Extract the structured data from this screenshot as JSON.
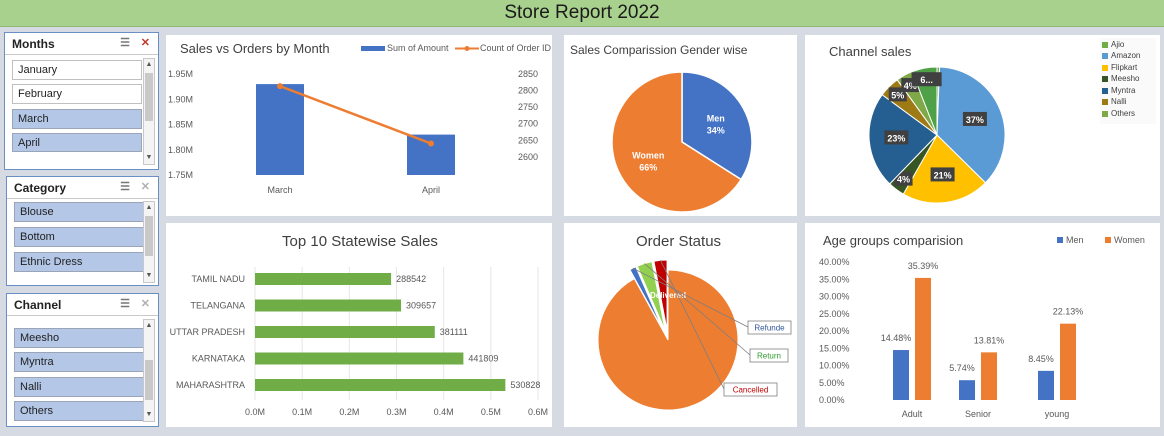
{
  "report_title": "Store Report 2022",
  "slicers": {
    "months": {
      "title": "Months",
      "items": [
        "January",
        "February",
        "March",
        "April"
      ],
      "selected": [
        false,
        false,
        true,
        true
      ]
    },
    "category": {
      "title": "Category",
      "items": [
        "Blouse",
        "Bottom",
        "Ethnic Dress"
      ],
      "selected": [
        true,
        true,
        true
      ]
    },
    "channel": {
      "title": "Channel",
      "items": [
        "Meesho",
        "Myntra",
        "Nalli",
        "Others"
      ],
      "selected": [
        true,
        true,
        true,
        true
      ]
    }
  },
  "chart_data": [
    {
      "type": "bar",
      "title": "Sales vs Orders  by Month",
      "categories": [
        "March",
        "April"
      ],
      "series": [
        {
          "name": "Sum of Amount",
          "values": [
            1930000,
            1830000
          ],
          "color": "#4472c4"
        },
        {
          "name": "Count of Order ID",
          "values": [
            2820,
            2678
          ],
          "color": "#ed7d31"
        }
      ],
      "y_ticks": [
        "1.95M",
        "1.90M",
        "1.85M",
        "1.80M",
        "1.75M"
      ],
      "y2_ticks": [
        "2850",
        "2800",
        "2750",
        "2700",
        "2650",
        "2600"
      ],
      "ylim": [
        1750000,
        1950000
      ],
      "y2lim": [
        2600,
        2850
      ]
    },
    {
      "type": "pie",
      "title": "Sales Comparission Gender wise",
      "slices": [
        {
          "label": "Men",
          "value": 34,
          "text": "34%",
          "color": "#4472c4"
        },
        {
          "label": "Women",
          "value": 66,
          "text": "66%",
          "color": "#ed7d31"
        }
      ]
    },
    {
      "type": "pie",
      "title": "Channel sales",
      "slices": [
        {
          "label": "Ajio",
          "value": 0.6,
          "text": "",
          "color": "#70ad47"
        },
        {
          "label": "Amazon",
          "value": 37,
          "text": "37%",
          "color": "#5b9bd5"
        },
        {
          "label": "Flipkart",
          "value": 21,
          "text": "21%",
          "color": "#ffc000"
        },
        {
          "label": "Meesho",
          "value": 4,
          "text": "4%",
          "color": "#375623"
        },
        {
          "label": "Myntra",
          "value": 23,
          "text": "23%",
          "color": "#255e91"
        },
        {
          "label": "Nalli",
          "value": 5,
          "text": "5%",
          "color": "#9e7a15"
        },
        {
          "label": "Others",
          "value": 4,
          "text": "4%",
          "color": "#7fa848"
        },
        {
          "label": "Ajio",
          "value": 6,
          "text": "6...",
          "color": "#4ea146"
        }
      ],
      "legend": [
        "Ajio",
        "Amazon",
        "Flipkart",
        "Meesho",
        "Myntra",
        "Nalli",
        "Others"
      ]
    },
    {
      "type": "bar",
      "title": "Top 10 Statewise Sales",
      "orientation": "horizontal",
      "categories": [
        "TAMIL NADU",
        "TELANGANA",
        "UTTAR PRADESH",
        "KARNATAKA",
        "MAHARASHTRA"
      ],
      "values": [
        288542,
        309657,
        381111,
        441809,
        530828
      ],
      "labels": [
        "288542",
        "309657",
        "381111",
        "441809",
        "530828"
      ],
      "x_ticks": [
        "0.0M",
        "0.1M",
        "0.2M",
        "0.3M",
        "0.4M",
        "0.5M",
        "0.6M"
      ],
      "xlim": [
        0,
        600000
      ],
      "color": "#70ad47"
    },
    {
      "type": "pie",
      "title": "Order Status",
      "slices": [
        {
          "label": "Delivered",
          "value": 92,
          "color": "#ed7d31"
        },
        {
          "label": "Refunde",
          "value": 1.5,
          "color": "#4472c4"
        },
        {
          "label": "Return",
          "value": 3.5,
          "color": "#92d050"
        },
        {
          "label": "Cancelled",
          "value": 3,
          "color": "#c00000"
        }
      ]
    },
    {
      "type": "bar",
      "title": "Age groups comparision",
      "categories": [
        "Adult",
        "Senior",
        "young"
      ],
      "series": [
        {
          "name": "Men",
          "values": [
            14.48,
            5.74,
            8.45
          ],
          "labels": [
            "14.48%",
            "5.74%",
            "8.45%"
          ],
          "color": "#4472c4"
        },
        {
          "name": "Women",
          "values": [
            35.39,
            13.81,
            22.13
          ],
          "labels": [
            "35.39%",
            "13.81%",
            "22.13%"
          ],
          "color": "#ed7d31"
        }
      ],
      "y_ticks": [
        "40.00%",
        "35.00%",
        "30.00%",
        "25.00%",
        "20.00%",
        "15.00%",
        "10.00%",
        "5.00%",
        "0.00%"
      ],
      "ylim": [
        0,
        40
      ]
    }
  ]
}
